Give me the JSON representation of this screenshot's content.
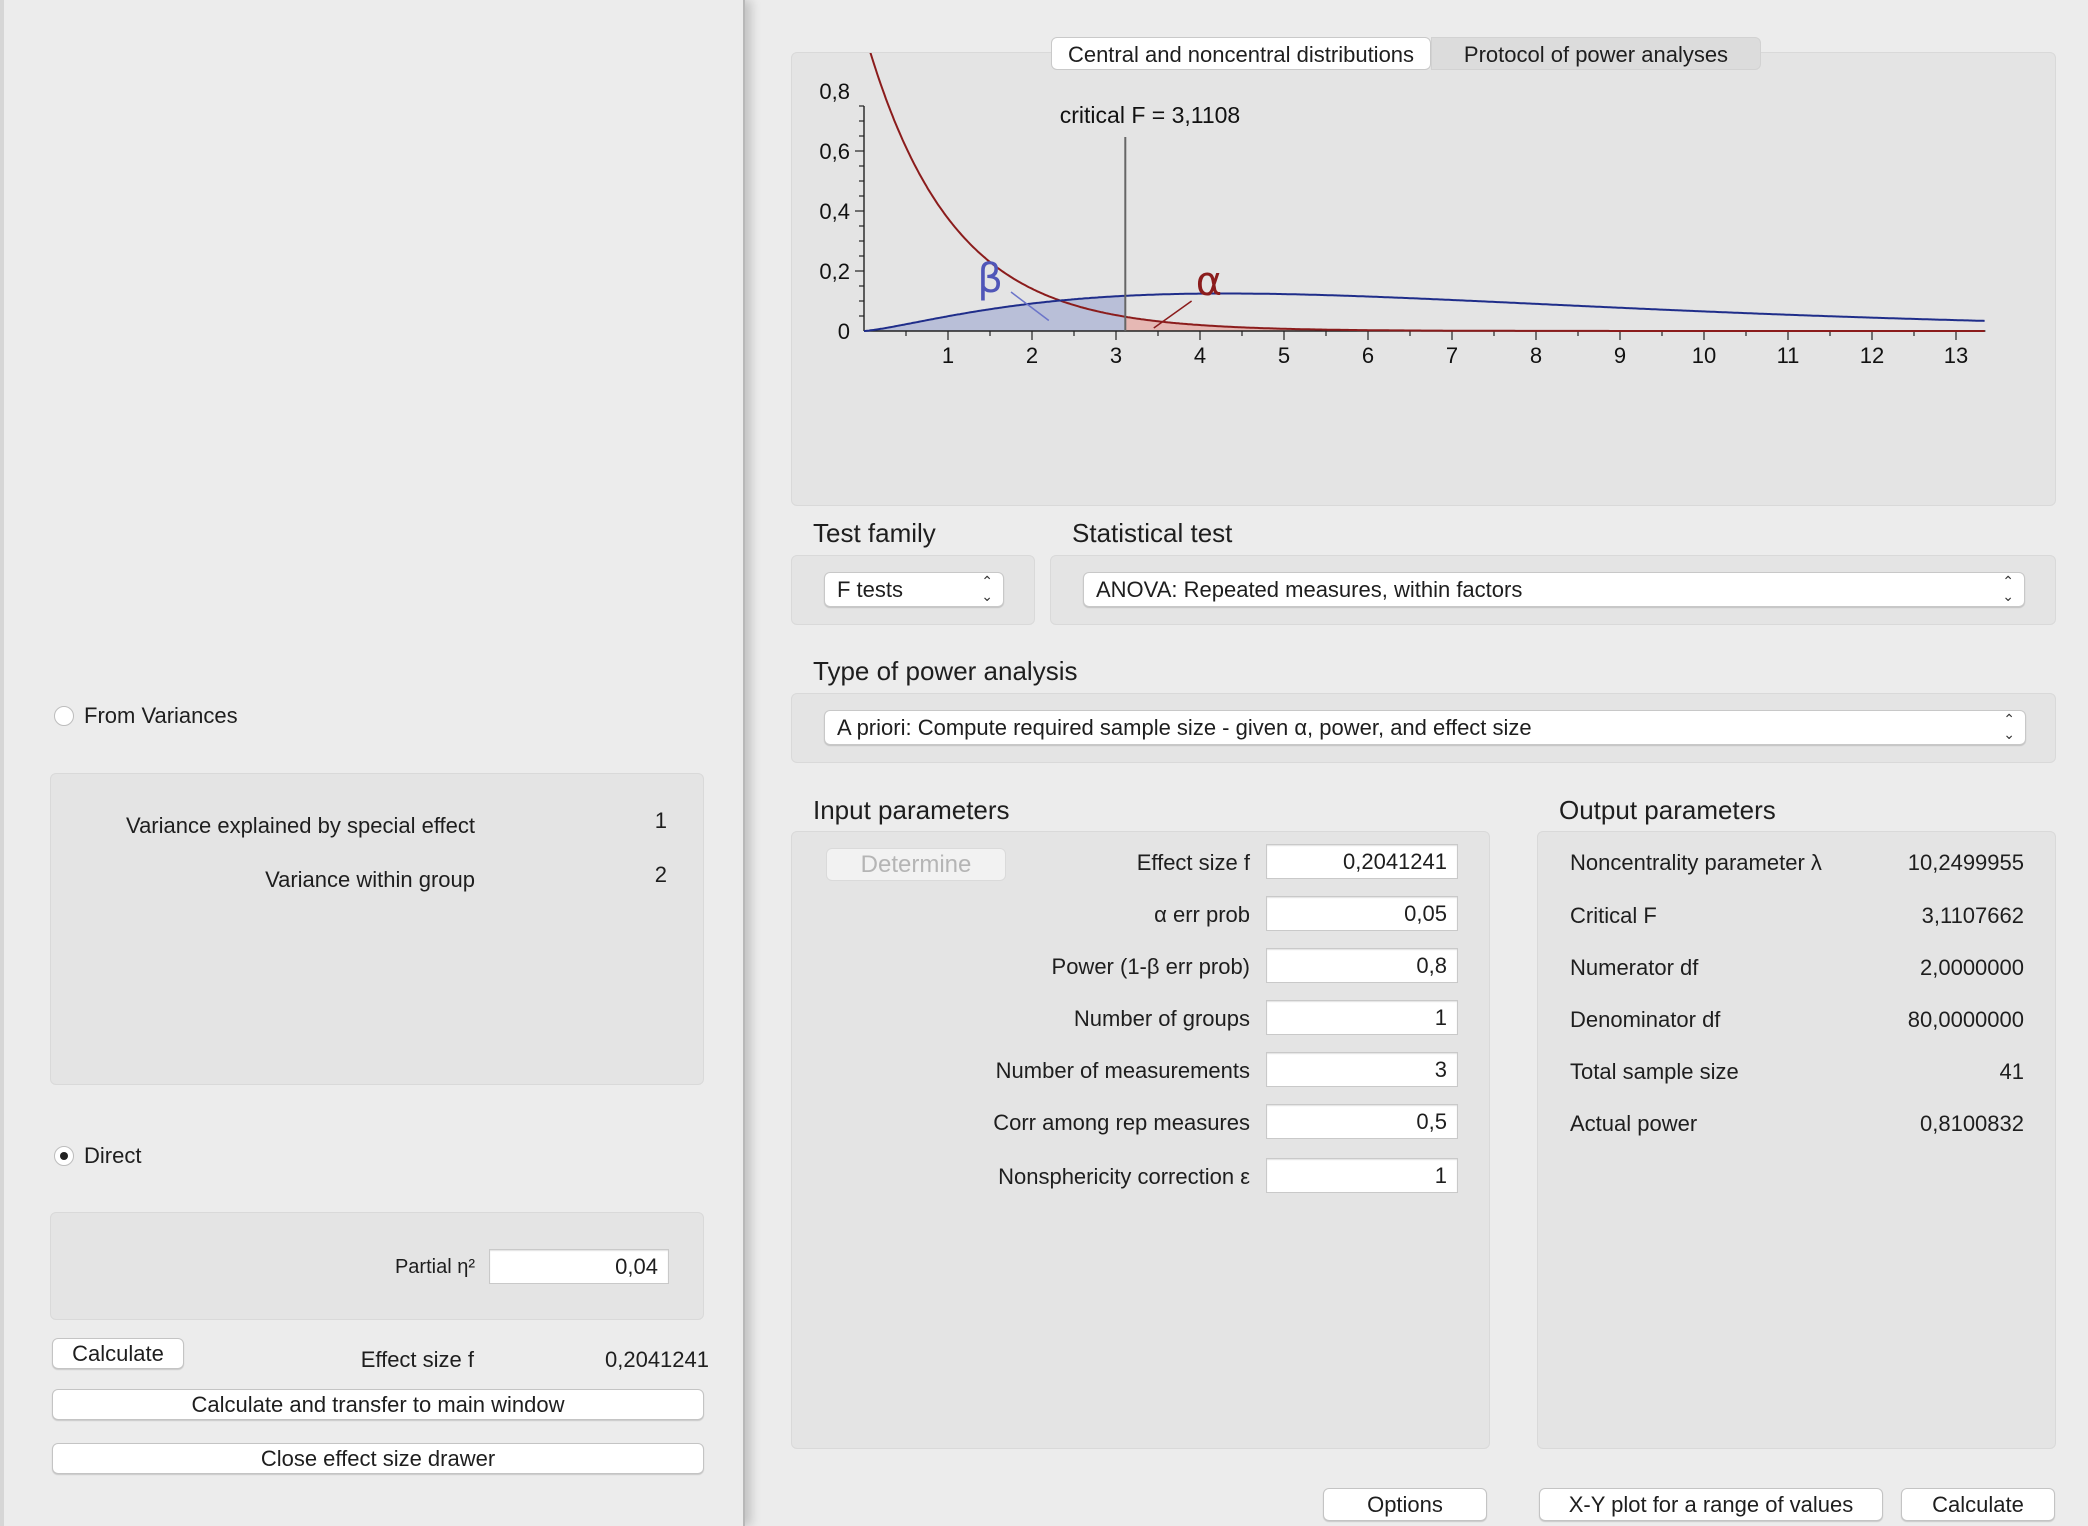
{
  "drawer": {
    "from_variances_label": "From Variances",
    "variance_effect_label": "Variance explained by special effect",
    "variance_effect_value": "1",
    "variance_within_label": "Variance within group",
    "variance_within_value": "2",
    "direct_label": "Direct",
    "partial_eta_label": "Partial η²",
    "partial_eta_value": "0,04",
    "calculate_button": "Calculate",
    "effect_size_label": "Effect size f",
    "effect_size_value": "0,2041241",
    "transfer_button": "Calculate and transfer to main window",
    "close_button": "Close effect size drawer"
  },
  "tabs": [
    "Central and noncentral distributions",
    "Protocol of power analyses"
  ],
  "plot": {
    "critical_label": "critical F = 3,1108",
    "beta_symbol": "β",
    "alpha_symbol": "α",
    "y_ticks": [
      "0",
      "0,2",
      "0,4",
      "0,6",
      "0,8"
    ],
    "x_ticks": [
      "1",
      "2",
      "3",
      "4",
      "5",
      "6",
      "7",
      "8",
      "9",
      "10",
      "11",
      "12",
      "13"
    ],
    "colors": {
      "central": "#8b1c1c",
      "noncentral": "#1f2d8a",
      "beta_fill": "#b9bfd8",
      "alpha_fill": "#e6b8b4"
    }
  },
  "test_family": {
    "label": "Test family",
    "value": "F tests"
  },
  "statistical_test": {
    "label": "Statistical test",
    "value": "ANOVA: Repeated measures, within factors"
  },
  "power_analysis": {
    "label": "Type of power analysis",
    "value": "A priori: Compute required sample size - given α, power, and effect size"
  },
  "input": {
    "title": "Input parameters",
    "determine_button": "Determine",
    "rows": [
      {
        "label": "Effect size f",
        "value": "0,2041241"
      },
      {
        "label": "α err prob",
        "value": "0,05"
      },
      {
        "label": "Power (1-β err prob)",
        "value": "0,8"
      },
      {
        "label": "Number of groups",
        "value": "1"
      },
      {
        "label": "Number of measurements",
        "value": "3"
      },
      {
        "label": "Corr among rep measures",
        "value": "0,5"
      },
      {
        "label": "Nonsphericity correction ε",
        "value": "1"
      }
    ]
  },
  "output": {
    "title": "Output parameters",
    "rows": [
      {
        "label": "Noncentrality parameter λ",
        "value": "10,2499955"
      },
      {
        "label": "Critical F",
        "value": "3,1107662"
      },
      {
        "label": "Numerator df",
        "value": "2,0000000"
      },
      {
        "label": "Denominator df",
        "value": "80,0000000"
      },
      {
        "label": "Total sample size",
        "value": "41"
      },
      {
        "label": "Actual power",
        "value": "0,8100832"
      }
    ]
  },
  "bottom": {
    "options_button": "Options",
    "xy_button": "X-Y plot for a range of values",
    "calculate_button": "Calculate"
  }
}
